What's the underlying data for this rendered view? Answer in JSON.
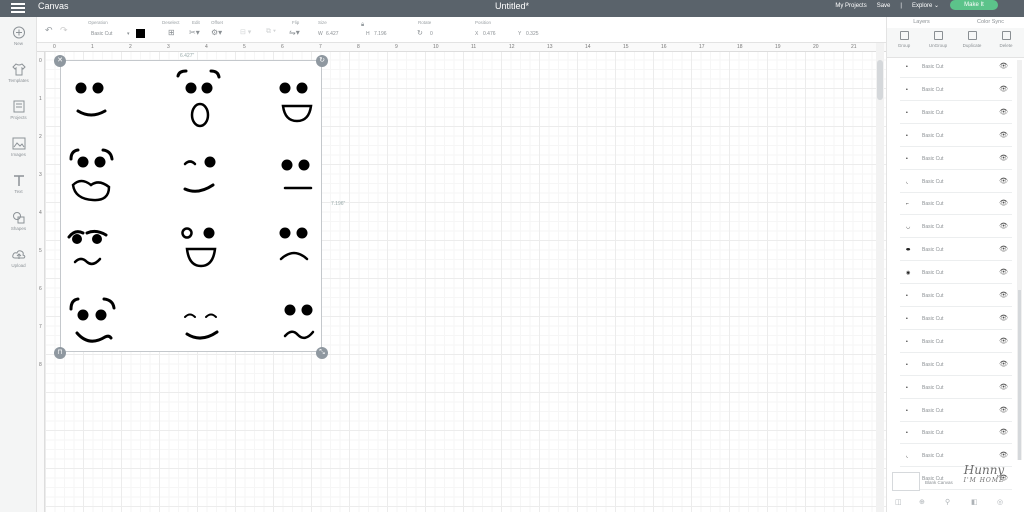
{
  "header": {
    "app_title": "Canvas",
    "doc_title": "Untitled*",
    "my_projects": "My Projects",
    "save": "Save",
    "separator": "|",
    "explore": "Explore",
    "make_it": "Make It"
  },
  "toolbar": {
    "undo_icon": "undo-icon",
    "redo_icon": "redo-icon",
    "operation_label": "Operation",
    "operation_value": "Basic Cut",
    "deselect_label": "Deselect",
    "edit_label": "Edit",
    "offset_label": "Offset",
    "align_label": "Align",
    "arrange_label": "Arrange",
    "flip_label": "Flip",
    "size_label": "Size",
    "size_w_prefix": "W",
    "size_w": "6.427",
    "size_h_prefix": "H",
    "size_h": "7.196",
    "rotate_label": "Rotate",
    "rotate_value": "0",
    "position_label": "Position",
    "pos_x_prefix": "X",
    "pos_x": "0.476",
    "pos_y_prefix": "Y",
    "pos_y": "0.325",
    "swatch_color": "#000000"
  },
  "left_sidebar": {
    "items": [
      {
        "label": "New",
        "icon": "plus-circle-icon"
      },
      {
        "label": "Templates",
        "icon": "shirt-icon"
      },
      {
        "label": "Projects",
        "icon": "projects-icon"
      },
      {
        "label": "Images",
        "icon": "image-icon"
      },
      {
        "label": "Text",
        "icon": "text-icon"
      },
      {
        "label": "Shapes",
        "icon": "shapes-icon"
      },
      {
        "label": "Upload",
        "icon": "upload-cloud-icon"
      }
    ]
  },
  "canvas": {
    "ruler_top": [
      "0",
      "1",
      "2",
      "3",
      "4",
      "5",
      "6",
      "7",
      "8",
      "9",
      "10",
      "11",
      "12",
      "13",
      "14",
      "15",
      "16",
      "17",
      "18",
      "19",
      "20",
      "21"
    ],
    "ruler_left": [
      "0",
      "1",
      "2",
      "3",
      "4",
      "5",
      "6",
      "7",
      "8"
    ],
    "width_label": "6.427\"",
    "height_label": "7.196\""
  },
  "right_panel": {
    "tabs": [
      "Layers",
      "Color Sync"
    ],
    "actions": [
      {
        "label": "Group",
        "icon": "group-icon"
      },
      {
        "label": "UnGroup",
        "icon": "ungroup-icon"
      },
      {
        "label": "Duplicate",
        "icon": "duplicate-icon"
      },
      {
        "label": "Delete",
        "icon": "trash-icon"
      }
    ],
    "layers": [
      {
        "name": "Basic Cut",
        "thumb": "•"
      },
      {
        "name": "Basic Cut",
        "thumb": "•"
      },
      {
        "name": "Basic Cut",
        "thumb": "•"
      },
      {
        "name": "Basic Cut",
        "thumb": "•"
      },
      {
        "name": "Basic Cut",
        "thumb": "•"
      },
      {
        "name": "Basic Cut",
        "thumb": "◟"
      },
      {
        "name": "Basic Cut",
        "thumb": "⌐"
      },
      {
        "name": "Basic Cut",
        "thumb": "◡"
      },
      {
        "name": "Basic Cut",
        "thumb": "⬬"
      },
      {
        "name": "Basic Cut",
        "thumb": "◉"
      },
      {
        "name": "Basic Cut",
        "thumb": "•"
      },
      {
        "name": "Basic Cut",
        "thumb": "•"
      },
      {
        "name": "Basic Cut",
        "thumb": "•"
      },
      {
        "name": "Basic Cut",
        "thumb": "•"
      },
      {
        "name": "Basic Cut",
        "thumb": "•"
      },
      {
        "name": "Basic Cut",
        "thumb": "•"
      },
      {
        "name": "Basic Cut",
        "thumb": "•"
      },
      {
        "name": "Basic Cut",
        "thumb": "◟"
      },
      {
        "name": "Basic Cut",
        "thumb": "•"
      }
    ],
    "blank_canvas": "Blank Canvas"
  },
  "watermark": {
    "line1": "Hunny",
    "line2": "I'M HOME"
  }
}
